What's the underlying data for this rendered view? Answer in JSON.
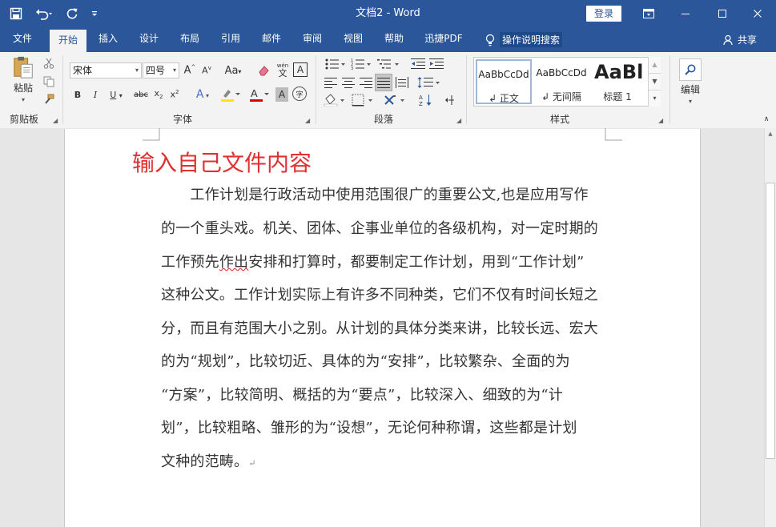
{
  "window": {
    "title": "文档2  -  Word",
    "login_label": "登录"
  },
  "tabs": [
    {
      "label": "文件"
    },
    {
      "label": "开始"
    },
    {
      "label": "插入"
    },
    {
      "label": "设计"
    },
    {
      "label": "布局"
    },
    {
      "label": "引用"
    },
    {
      "label": "邮件"
    },
    {
      "label": "审阅"
    },
    {
      "label": "视图"
    },
    {
      "label": "帮助"
    },
    {
      "label": "迅捷PDF"
    }
  ],
  "tell_me": "操作说明搜索",
  "share_label": "共享",
  "ribbon": {
    "clipboard": {
      "paste_label": "粘贴",
      "group_label": "剪贴板"
    },
    "font": {
      "font_name": "宋体",
      "font_size": "四号",
      "group_label": "字体",
      "wen_label": "wén",
      "wen_char": "文",
      "boxed_char": "A",
      "circle_char": "字"
    },
    "paragraph": {
      "group_label": "段落"
    },
    "styles": {
      "items": [
        {
          "sample": "AaBbCcDd",
          "name": "↲ 正文"
        },
        {
          "sample": "AaBbCcDd",
          "name": "↲ 无间隔"
        },
        {
          "sample": "AaBl",
          "name": "标题 1"
        }
      ],
      "group_label": "样式"
    },
    "editing": {
      "label": "编辑"
    }
  },
  "document": {
    "title": "输入自己文件内容",
    "lines": [
      {
        "pre": "　　工作计划是行政活动中使用范围很广的重要公文,也是应用写作",
        "err": "",
        "post": ""
      },
      {
        "pre": "的一个重头戏。机关、团体、企事业单位的各级机构，对一定时期的",
        "err": "",
        "post": ""
      },
      {
        "pre": "工作预先",
        "err": "作出",
        "post": "安排和打算时，都要制定工作计划，用到“工作计划”"
      },
      {
        "pre": "这种公文。工作计划实际上有许多不同种类，它们不仅有时间长短之",
        "err": "",
        "post": ""
      },
      {
        "pre": "分，而且有范围大小之别。从计划的具体分类来讲，比较长远、宏大",
        "err": "",
        "post": ""
      },
      {
        "pre": "的为“规划”，比较切近、具体的为“安排”，比较繁杂、全面的为",
        "err": "",
        "post": ""
      },
      {
        "pre": "“方案”，比较简明、概括的为“要点”，比较深入、细致的为“计",
        "err": "",
        "post": ""
      },
      {
        "pre": "划”，比较粗略、雏形的为“设想”，无论何种称谓，这些都是计划",
        "err": "",
        "post": ""
      },
      {
        "pre": "文种的范畴。",
        "err": "",
        "post": "↵"
      }
    ]
  }
}
